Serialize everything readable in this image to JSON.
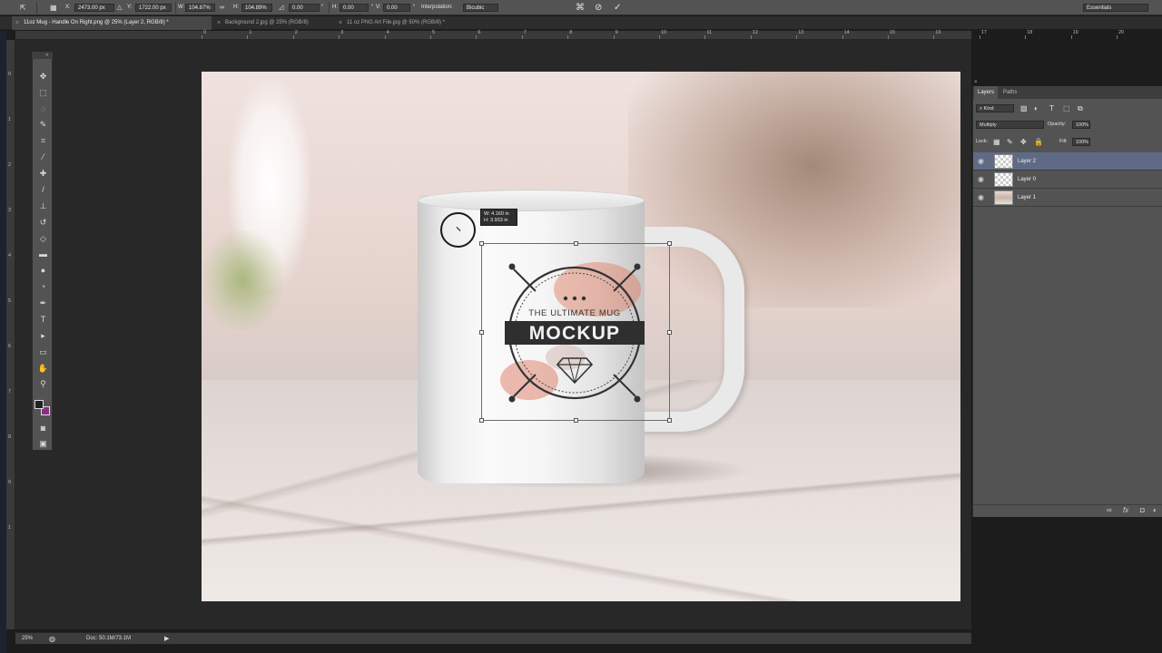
{
  "options_bar": {
    "x_label": "X:",
    "x_value": "2473.00 px",
    "y_label": "Y:",
    "y_value": "1722.00 px",
    "w_label": "W:",
    "w_value": "104.87%",
    "h_label": "H:",
    "h_value": "104.89%",
    "rotate_value": "0.00",
    "hskew_label": "H:",
    "hskew_value": "0.00",
    "vskew_label": "V:",
    "vskew_value": "0.00",
    "interp_label": "Interpolation:",
    "interp_value": "Bicubic",
    "workspace": "Essentials"
  },
  "tabs": [
    {
      "label": "11oz Mug - Handle On Right.png @ 25% (Layer 2, RGB/8) *"
    },
    {
      "label": "Background 2.jpg @ 25% (RGB/8)"
    },
    {
      "label": "11 oz PNG Art File.jpg @ 50% (RGB/8) *"
    }
  ],
  "ruler_top": [
    "0",
    "1",
    "2",
    "3",
    "4",
    "5",
    "6",
    "7",
    "8",
    "9",
    "10",
    "11",
    "12",
    "13",
    "14",
    "15",
    "16",
    "17",
    "18",
    "19",
    "20"
  ],
  "ruler_left": [
    "0",
    "1",
    "2",
    "3",
    "4",
    "5",
    "6",
    "7",
    "8",
    "9",
    "1"
  ],
  "canvas": {
    "tooltip_w": "W: 4.160 in",
    "tooltip_h": "H: 3.933 in",
    "logo_top_text": "THE ULTIMATE MUG",
    "logo_main_text": "MOCKUP"
  },
  "layers_panel": {
    "tabs": [
      "Layers",
      "Paths"
    ],
    "kind_label": "⌕ Kind",
    "blend_mode": "Multiply",
    "opacity_label": "Opacity:",
    "opacity_value": "100%",
    "lock_label": "Lock:",
    "fill_label": "Fill:",
    "fill_value": "100%",
    "layers": [
      {
        "name": "Layer 2",
        "selected": true
      },
      {
        "name": "Layer 0",
        "selected": false
      },
      {
        "name": "Layer 1",
        "selected": false
      }
    ]
  },
  "status_bar": {
    "zoom": "25%",
    "doc": "Doc: 50.1M/73.1M"
  },
  "colors": {
    "foreground": "#222222",
    "background": "#8e2b86",
    "selection": "#5f6a86"
  }
}
